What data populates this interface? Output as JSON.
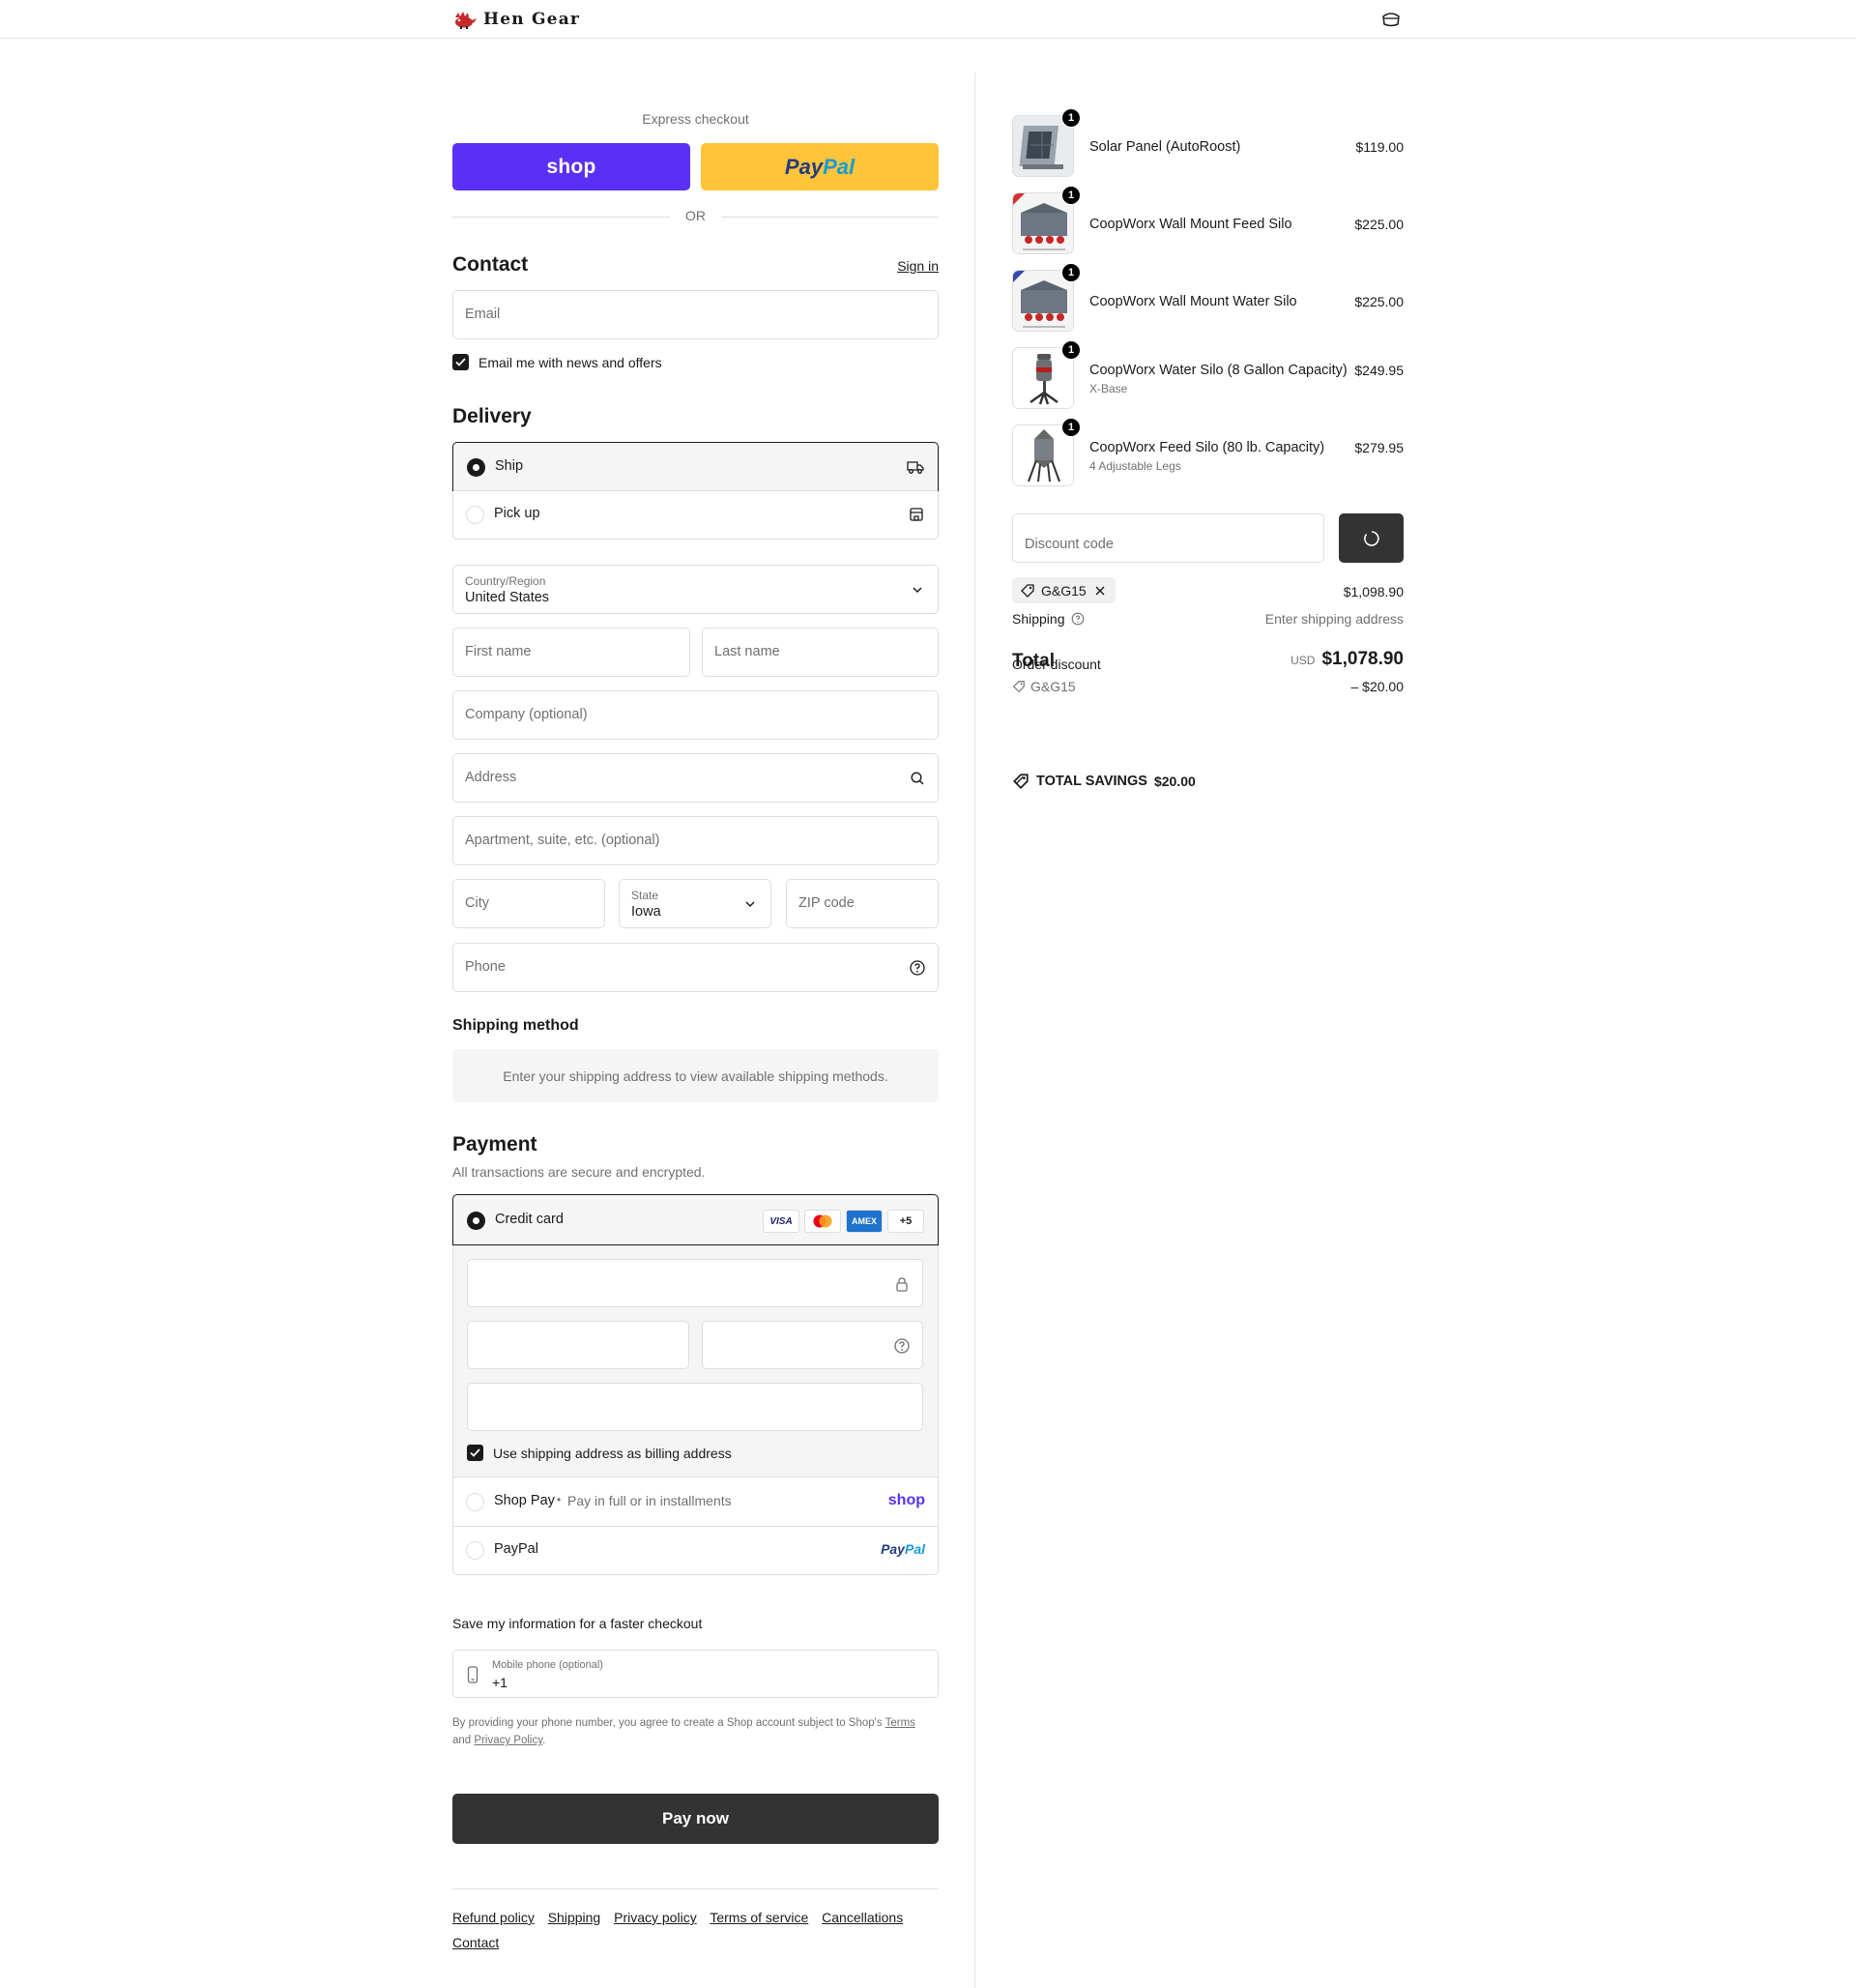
{
  "brand": {
    "name": "Hen Gear"
  },
  "express": {
    "title": "Express checkout",
    "shop_label": "shop",
    "paypal_dark": "Pay",
    "paypal_light": "Pal",
    "or": "OR"
  },
  "contact": {
    "title": "Contact",
    "sign_in": "Sign in",
    "email_placeholder": "Email",
    "newsletter_label": "Email me with news and offers",
    "newsletter_checked": true
  },
  "delivery": {
    "title": "Delivery",
    "options": [
      {
        "label": "Ship",
        "selected": true
      },
      {
        "label": "Pick up",
        "selected": false
      }
    ],
    "country_label": "Country/Region",
    "country_value": "United States",
    "first_name": "First name",
    "last_name": "Last name",
    "company": "Company (optional)",
    "address": "Address",
    "apartment": "Apartment, suite, etc. (optional)",
    "city": "City",
    "state_label": "State",
    "state_value": "Iowa",
    "zip": "ZIP code",
    "phone": "Phone"
  },
  "shipping_method": {
    "title": "Shipping method",
    "notice": "Enter your shipping address to view available shipping methods."
  },
  "payment": {
    "title": "Payment",
    "subtitle": "All transactions are secure and encrypted.",
    "credit_card_label": "Credit card",
    "card_logos": [
      "VISA",
      "AMEX",
      "+5"
    ],
    "billing_same_label": "Use shipping address as billing address",
    "billing_same_checked": true,
    "shop_pay_label": "Shop Pay",
    "shop_pay_sep": "•",
    "shop_pay_desc": "Pay in full or in installments",
    "shop_pay_logo": "shop",
    "paypal_label": "PayPal",
    "paypal_logo_dark": "Pay",
    "paypal_logo_light": "Pal"
  },
  "save_info": {
    "title": "Save my information for a faster checkout",
    "mobile_label": "Mobile phone (optional)",
    "mobile_value": "+1",
    "legal_prefix": "By providing your phone number, you agree to create a Shop account subject to Shop's",
    "terms": "Terms",
    "and": "and",
    "privacy": "Privacy Policy",
    "period": "."
  },
  "pay_now": "Pay now",
  "footer_links": [
    "Refund policy",
    "Shipping",
    "Privacy policy",
    "Terms of service",
    "Cancellations",
    "Contact"
  ],
  "order": {
    "items": [
      {
        "name": "Solar Panel (AutoRoost)",
        "variant": "",
        "qty": "1",
        "price": "$119.00"
      },
      {
        "name": "CoopWorx Wall Mount Feed Silo",
        "variant": "",
        "qty": "1",
        "price": "$225.00"
      },
      {
        "name": "CoopWorx Wall Mount Water Silo",
        "variant": "",
        "qty": "1",
        "price": "$225.00"
      },
      {
        "name": "CoopWorx Water Silo (8 Gallon Capacity)",
        "variant": "X-Base",
        "qty": "1",
        "price": "$249.95"
      },
      {
        "name": "CoopWorx Feed Silo (80 lb. Capacity)",
        "variant": "4 Adjustable Legs",
        "qty": "1",
        "price": "$279.95"
      }
    ],
    "discount_placeholder": "Discount code",
    "applied_code": "G&G15",
    "subtotal_value": "$1,098.90",
    "shipping_label": "Shipping",
    "shipping_value": "Enter shipping address",
    "total_label": "Total",
    "order_discount_label": "Order discount",
    "currency": "USD",
    "total_value": "$1,078.90",
    "discount_code_row": "G&G15",
    "discount_value": "– $20.00",
    "savings_label": "TOTAL SAVINGS",
    "savings_value": "$20.00"
  },
  "colors": {
    "shop_purple": "#5a31f4",
    "paypal_yellow": "#ffc439",
    "dark_button": "#333333",
    "border": "#dedede"
  }
}
